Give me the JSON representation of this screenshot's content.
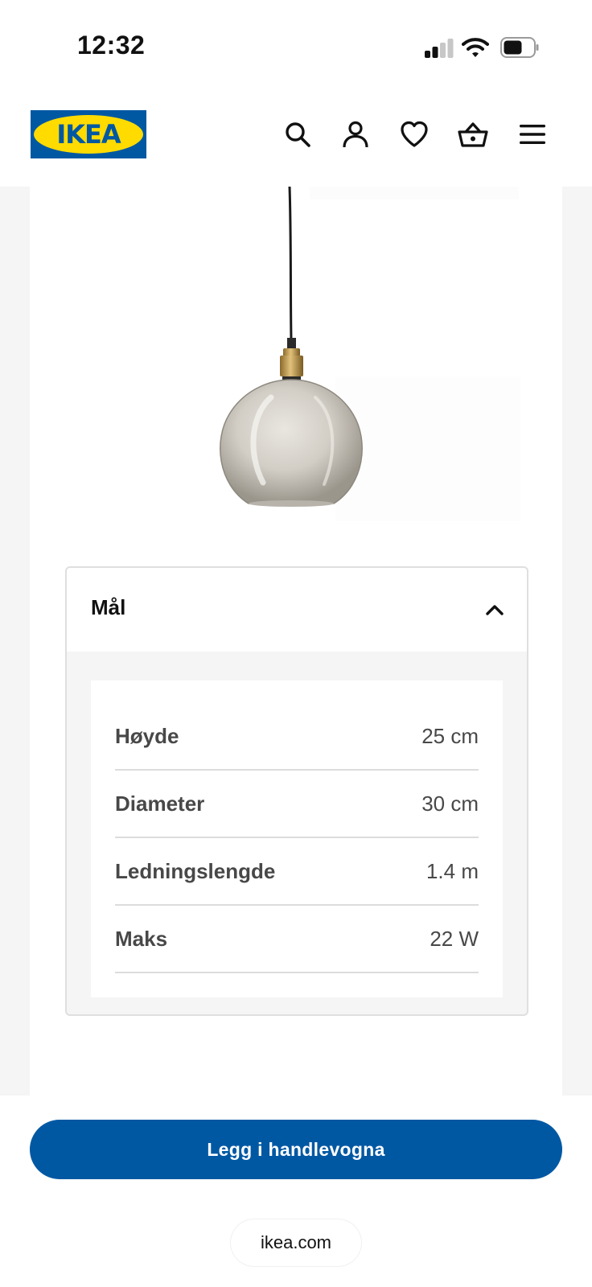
{
  "status_bar": {
    "time": "12:32",
    "icons": [
      "cellular-signal-icon",
      "wifi-icon",
      "battery-icon"
    ]
  },
  "header": {
    "logo_text": "IKEA",
    "brand_colors": {
      "blue": "#0058a3",
      "yellow": "#ffdb00"
    },
    "icons": [
      "search-icon",
      "account-icon",
      "heart-icon",
      "shopping-basket-icon",
      "menu-icon"
    ]
  },
  "dimensions": {
    "title": "Mål",
    "expanded": true,
    "rows": [
      {
        "label": "Høyde",
        "value": "25 cm"
      },
      {
        "label": "Diameter",
        "value": "30 cm"
      },
      {
        "label": "Ledningslengde",
        "value": "1.4 m"
      },
      {
        "label": "Maks",
        "value": "22 W"
      }
    ]
  },
  "cart_button": {
    "label": "Legg i handlevogna",
    "color": "#0058a3"
  },
  "browser": {
    "url": "ikea.com"
  }
}
